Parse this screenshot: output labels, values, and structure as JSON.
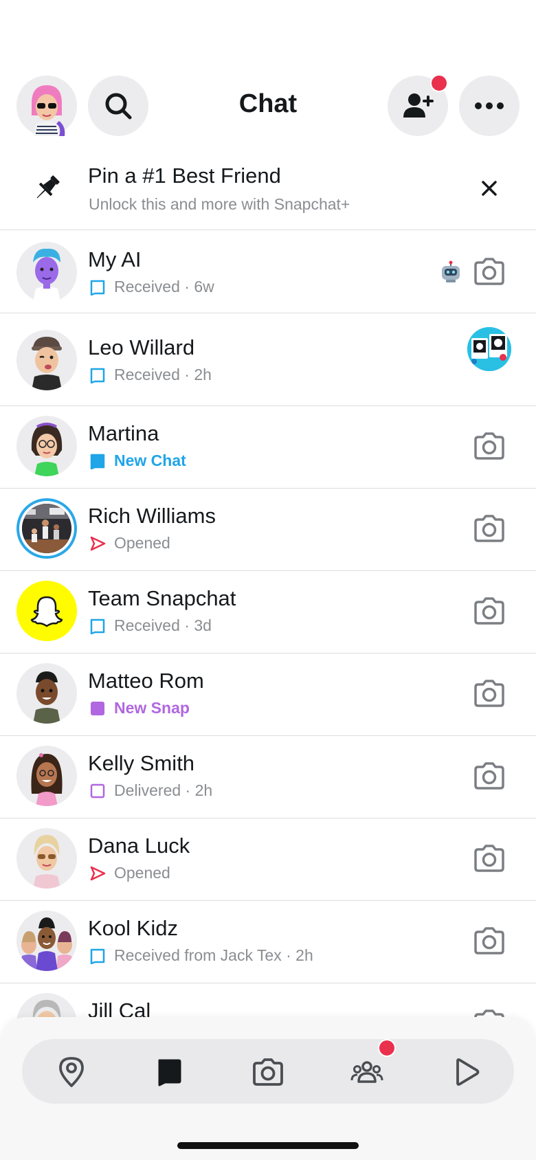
{
  "header": {
    "title": "Chat"
  },
  "pin_banner": {
    "title": "Pin a #1 Best Friend",
    "subtitle": "Unlock this and more with Snapchat+"
  },
  "chats": [
    {
      "name": "My AI",
      "status": "Received · 6w",
      "status_type": "received"
    },
    {
      "name": "Leo Willard",
      "status": "Received · 2h",
      "status_type": "received"
    },
    {
      "name": "Martina",
      "status": "New Chat",
      "status_type": "new_chat"
    },
    {
      "name": "Rich Williams",
      "status": "Opened",
      "status_type": "opened"
    },
    {
      "name": "Team Snapchat",
      "status": "Received · 3d",
      "status_type": "received"
    },
    {
      "name": "Matteo Rom",
      "status": "New Snap",
      "status_type": "new_snap"
    },
    {
      "name": "Kelly Smith",
      "status": "Delivered · 2h",
      "status_type": "delivered"
    },
    {
      "name": "Dana Luck",
      "status": "Opened",
      "status_type": "opened"
    },
    {
      "name": "Kool Kidz",
      "status": "Received from Jack Tex · 2h",
      "status_type": "received"
    },
    {
      "name": "Jill Cal",
      "status": "",
      "status_type": "partial"
    }
  ],
  "colors": {
    "chat_blue": "#1fa5e8",
    "snap_purple": "#b067e0",
    "opened_red": "#e9304c",
    "notification_dot": "#e9304c",
    "snapchat_yellow": "#fffc00"
  },
  "icons": {
    "header_left": [
      "profile-avatar",
      "search-icon"
    ],
    "header_right": [
      "add-friend-icon",
      "more-icon"
    ],
    "tabs": [
      "map-icon",
      "chat-icon",
      "camera-icon",
      "stories-icon",
      "spotlight-icon"
    ]
  }
}
